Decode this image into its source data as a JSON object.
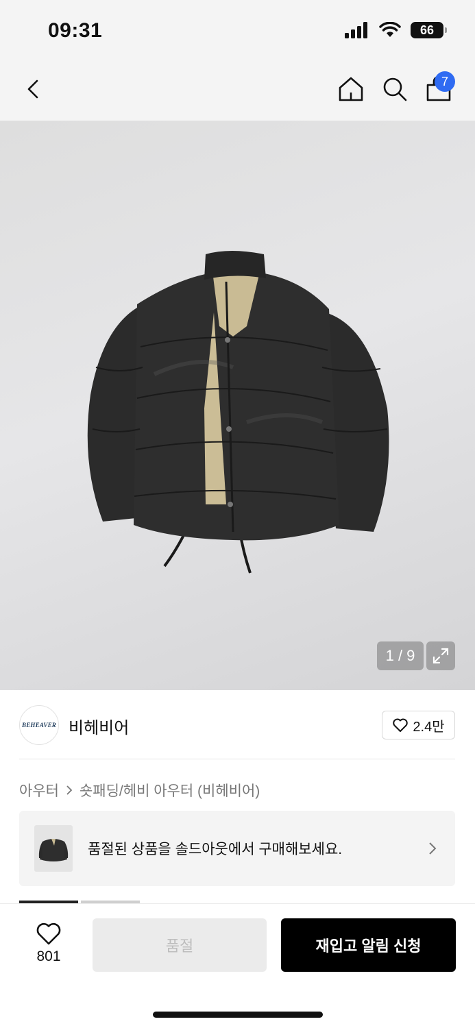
{
  "status_bar": {
    "time": "09:31",
    "battery": "66"
  },
  "nav": {
    "cart_count": "7"
  },
  "gallery": {
    "counter": "1 / 9"
  },
  "brand": {
    "logo_text": "BEHEAVER",
    "name": "비헤비어",
    "likes": "2.4만"
  },
  "breadcrumb": {
    "category": "아우터",
    "subcategory": "숏패딩/헤비 아우터 (비헤비어)"
  },
  "soldout_banner": {
    "text": "품절된 상품을 솔드아웃에서 구매해보세요."
  },
  "bottom_bar": {
    "wish_count": "801",
    "soldout_label": "품절",
    "restock_label": "재입고 알림 신청"
  },
  "colors": {
    "accent_blue": "#2f6bf2",
    "primary_black": "#000000",
    "disabled_gray": "#ebebeb"
  }
}
